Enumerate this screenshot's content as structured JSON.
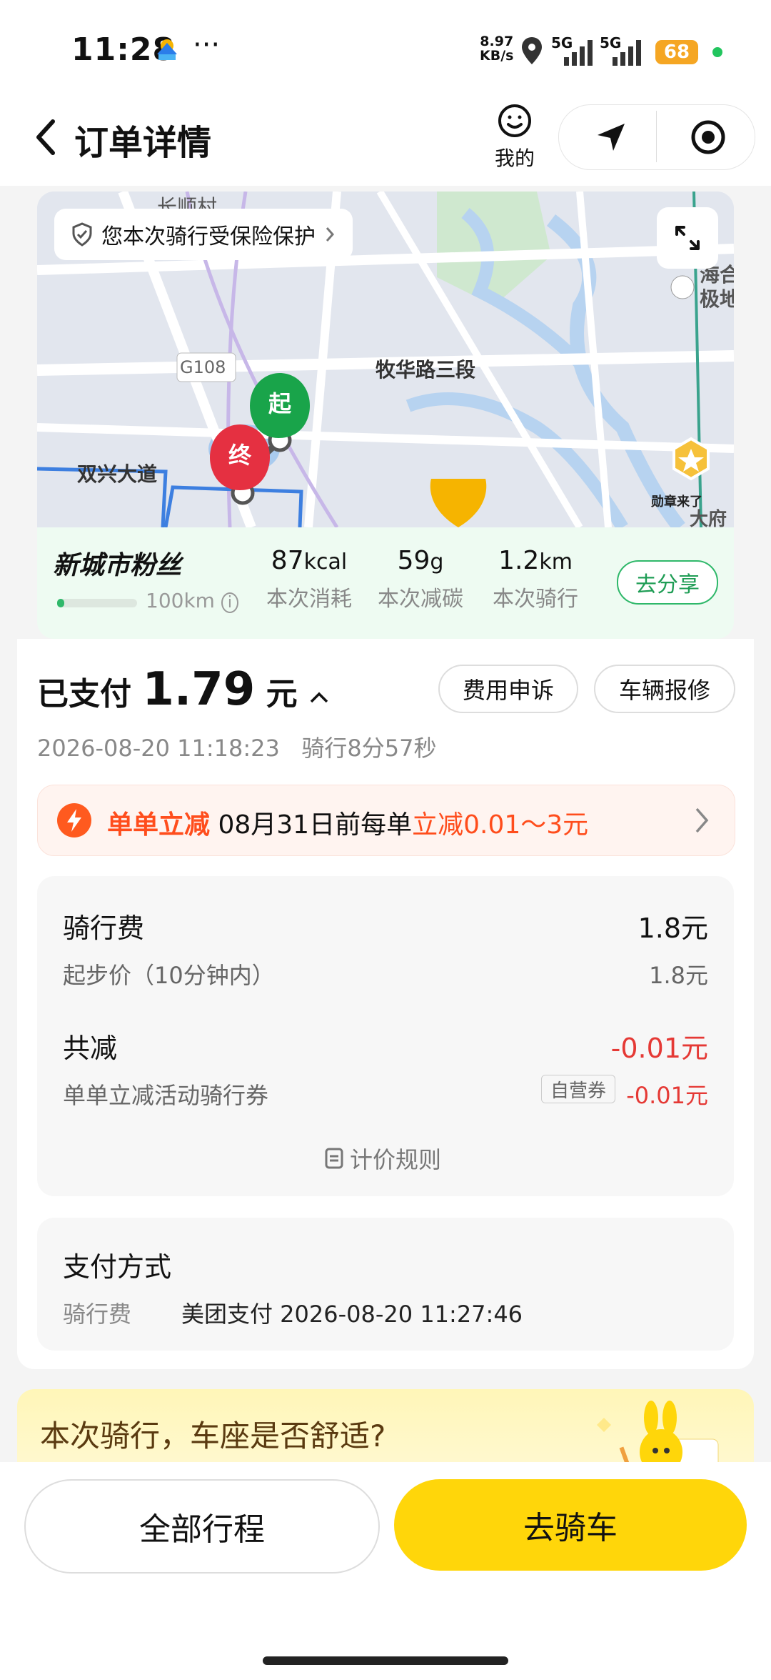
{
  "status_bar": {
    "time": "11:28",
    "extra": "···",
    "net_speed_value": "8.97",
    "net_speed_unit": "KB/s",
    "signal1": "5G",
    "signal2": "5G",
    "battery": "68"
  },
  "header": {
    "title": "订单详情",
    "mine_label": "我的"
  },
  "map": {
    "insurance_text": "您本次骑行受保险保护",
    "road_label": "G108",
    "road2_label": "双兴大道",
    "place_label": "牧华路三段",
    "start_marker": "起",
    "end_marker": "终",
    "top_right_label": "海合\n极地",
    "bottom_right_label": "大府",
    "badge_label": "勋章来了",
    "partial_top_label": "长顺村"
  },
  "fan": {
    "title": "新城市粉丝",
    "progress_label": "100km",
    "progress_fraction": 0.05,
    "stats": [
      {
        "value": "87",
        "unit": "kcal",
        "label": "本次消耗"
      },
      {
        "value": "59",
        "unit": "g",
        "label": "本次减碳"
      },
      {
        "value": "1.2",
        "unit": "km",
        "label": "本次骑行"
      }
    ],
    "share_label": "去分享"
  },
  "payment": {
    "paid_prefix": "已支付",
    "amount": "1.79",
    "currency": "元",
    "appeal_label": "费用申诉",
    "repair_label": "车辆报修",
    "datetime": "2026-08-20 11:18:23",
    "duration": "骑行8分57秒"
  },
  "promo": {
    "title": "单单立减",
    "text": "08月31日前每单",
    "highlight": "立减0.01～3元"
  },
  "fees": {
    "ride_fee_label": "骑行费",
    "ride_fee_value": "1.8元",
    "base_label": "起步价（10分钟内）",
    "base_value": "1.8元",
    "discount_label": "共减",
    "discount_value": "-0.01元",
    "coupon_label": "单单立减活动骑行券",
    "coupon_tag": "自营券",
    "coupon_value": "-0.01元",
    "rule_label": "计价规则"
  },
  "pay_method": {
    "title": "支付方式",
    "item_label": "骑行费",
    "item_value": "美团支付 2026-08-20 11:27:46"
  },
  "survey": {
    "question": "本次骑行，车座是否舒适?"
  },
  "bottom": {
    "all_trips_label": "全部行程",
    "ride_label": "去骑车"
  },
  "colors": {
    "brand_yellow": "#ffd60a",
    "green": "#2fb86a",
    "promo_red": "#ff4d1c",
    "negative_red": "#e53935"
  }
}
